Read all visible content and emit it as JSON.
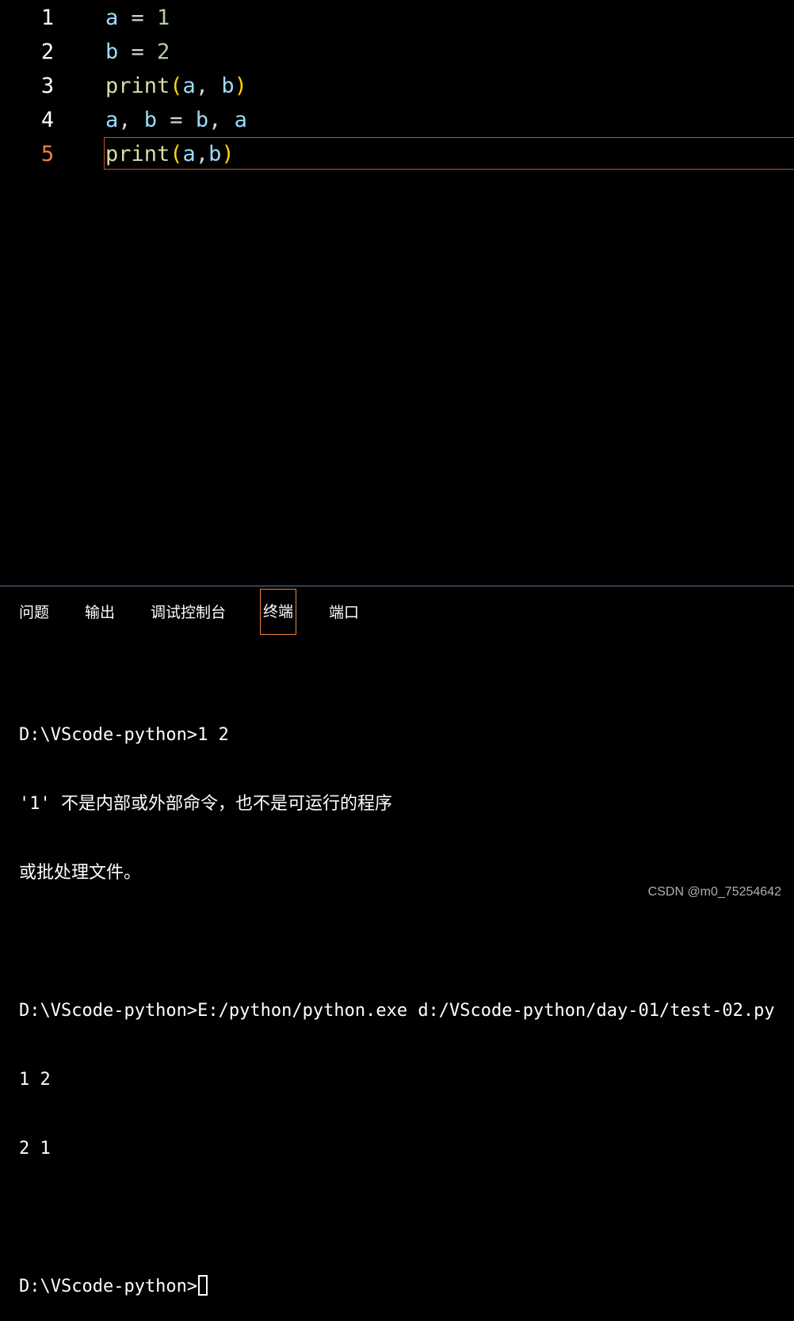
{
  "editor": {
    "lines": [
      {
        "number": "1",
        "tokens": [
          {
            "t": "a",
            "c": "var"
          },
          {
            "t": " = ",
            "c": "op"
          },
          {
            "t": "1",
            "c": "num"
          }
        ]
      },
      {
        "number": "2",
        "tokens": [
          {
            "t": "b",
            "c": "var"
          },
          {
            "t": " = ",
            "c": "op"
          },
          {
            "t": "2",
            "c": "num"
          }
        ]
      },
      {
        "number": "3",
        "tokens": [
          {
            "t": "print",
            "c": "fn"
          },
          {
            "t": "(",
            "c": "paren"
          },
          {
            "t": "a",
            "c": "var"
          },
          {
            "t": ", ",
            "c": "op"
          },
          {
            "t": "b",
            "c": "var"
          },
          {
            "t": ")",
            "c": "paren"
          }
        ]
      },
      {
        "number": "4",
        "tokens": [
          {
            "t": "a",
            "c": "var"
          },
          {
            "t": ", ",
            "c": "op"
          },
          {
            "t": "b",
            "c": "var"
          },
          {
            "t": " = ",
            "c": "op"
          },
          {
            "t": "b",
            "c": "var"
          },
          {
            "t": ", ",
            "c": "op"
          },
          {
            "t": "a",
            "c": "var"
          }
        ]
      },
      {
        "number": "5",
        "tokens": [
          {
            "t": "print",
            "c": "fn"
          },
          {
            "t": "(",
            "c": "paren"
          },
          {
            "t": "a",
            "c": "var"
          },
          {
            "t": ",",
            "c": "op"
          },
          {
            "t": "b",
            "c": "var"
          },
          {
            "t": ")",
            "c": "paren"
          }
        ]
      }
    ],
    "active_line": "5"
  },
  "panel": {
    "tabs": [
      {
        "label": "问题",
        "active": false
      },
      {
        "label": "输出",
        "active": false
      },
      {
        "label": "调试控制台",
        "active": false
      },
      {
        "label": "终端",
        "active": true
      },
      {
        "label": "端口",
        "active": false
      }
    ]
  },
  "terminal": {
    "lines": [
      "D:\\VScode-python>1 2",
      "'1' 不是内部或外部命令，也不是可运行的程序",
      "或批处理文件。",
      "",
      "D:\\VScode-python>E:/python/python.exe d:/VScode-python/day-01/test-02.py",
      "1 2",
      "2 1",
      ""
    ],
    "prompt": "D:\\VScode-python>"
  },
  "watermark": "CSDN @m0_75254642",
  "colors": {
    "accent": "#f0823c",
    "variable": "#9cdcfe",
    "number": "#b5cea8",
    "function": "#dcdcaa",
    "paren": "#ffd700"
  }
}
